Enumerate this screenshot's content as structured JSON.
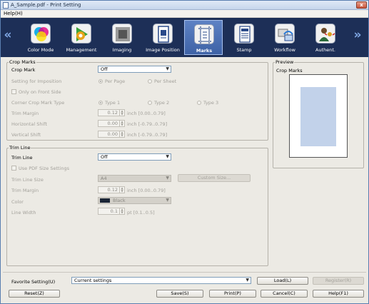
{
  "window": {
    "title": "A_Sample.pdf - Print Setting",
    "close_label": "x"
  },
  "menu": {
    "help": "Help(H)"
  },
  "toolbar": {
    "left_arrow": "«",
    "right_arrow": "»",
    "items": [
      {
        "label": "Color Mode",
        "icon": "color-mode-icon"
      },
      {
        "label": "Management",
        "icon": "management-icon"
      },
      {
        "label": "Imaging",
        "icon": "imaging-icon"
      },
      {
        "label": "Image Position",
        "icon": "image-position-icon"
      },
      {
        "label": "Marks",
        "icon": "marks-icon",
        "active": true
      },
      {
        "label": "Stamp",
        "icon": "stamp-icon"
      },
      {
        "label": "Workflow",
        "icon": "workflow-icon"
      },
      {
        "label": "Authent.",
        "icon": "authentication-icon"
      }
    ]
  },
  "crop_marks": {
    "title": "Crop Marks",
    "crop_mark_label": "Crop Mark",
    "crop_mark_value": "Off",
    "imposition_label": "Setting for Imposition",
    "per_page": "Per Page",
    "per_sheet": "Per Sheet",
    "only_front": "Only on Front Side",
    "corner_type_label": "Corner Crop Mark Type",
    "type1": "Type 1",
    "type2": "Type 2",
    "type3": "Type 3",
    "trim_margin_label": "Trim Margin",
    "trim_margin_value": "0.12",
    "trim_margin_unit": "inch [0.00..0.79]",
    "h_shift_label": "Horizontal Shift",
    "h_shift_value": "0.00",
    "h_shift_unit": "inch [-0.79..0.79]",
    "v_shift_label": "Vertical Shift",
    "v_shift_value": "0.00",
    "v_shift_unit": "inch [-0.79..0.79]"
  },
  "trim_line": {
    "title": "Trim Line",
    "trim_line_label": "Trim Line",
    "trim_line_value": "Off",
    "use_pdf_size": "Use PDF Size Settings",
    "size_label": "Trim Line Size",
    "size_value": "A4",
    "custom_size_button": "Custom Size...",
    "margin_label": "Trim Margin",
    "margin_value": "0.12",
    "margin_unit": "inch [0.00..0.79]",
    "color_label": "Color",
    "color_value": "Black",
    "color_swatch": "#1b2636",
    "width_label": "Line Width",
    "width_value": "0.1",
    "width_unit": "pt [0.1..0.5]"
  },
  "preview": {
    "title": "Preview",
    "subtitle": "Crop Marks"
  },
  "footer": {
    "favorite_label": "Favorite Setting(U)",
    "favorite_value": "Current settings",
    "load_button": "Load(L)",
    "register_button": "Register(R)",
    "reset_button": "Reset(Z)",
    "save_button": "Save(S)",
    "print_button": "Print(P)",
    "cancel_button": "Cancel(C)",
    "help_button": "Help(F1)"
  }
}
